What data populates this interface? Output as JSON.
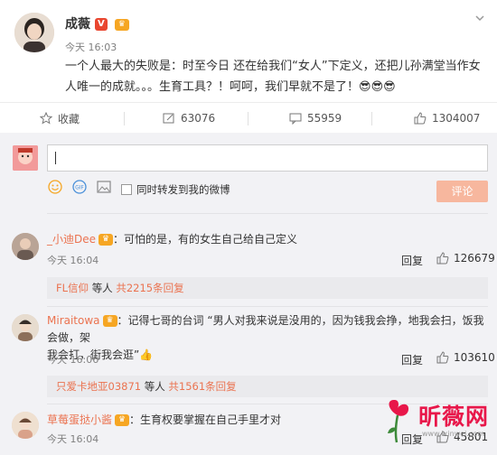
{
  "post": {
    "author": "成薇",
    "time": "今天 16:03",
    "text_line1": "一个人最大的失败是：时至今日 还在给我们“女人”下定义，还把儿孙满堂当作女",
    "text_line2": "人唯一的成就。。。生育工具？！呵呵，我们早就不是了！",
    "emoji": "😎😎😎"
  },
  "actions": {
    "favorite": "收藏",
    "repost": "63076",
    "comment": "55959",
    "like": "1304007"
  },
  "composer": {
    "value": "",
    "sync_label": "同时转发到我的微博",
    "submit": "评论"
  },
  "comments": [
    {
      "user": "_小迪Dee",
      "text": "：可怕的是，有的女生自己给自己定义",
      "time": "今天 16:04",
      "reply": "回复",
      "likes": "126679",
      "sub_user": "FL信仰",
      "sub_mid": "等人",
      "sub_more": "共2215条回复"
    },
    {
      "user": "Miraitowa",
      "text_line1": "：记得七哥的台词 “男人对我来说是没用的，因为钱我会挣，地我会扫，饭我会做，架",
      "text_line2": "我会打，街我会逛”",
      "time": "今天 16:06",
      "reply": "回复",
      "likes": "103610",
      "sub_user": "只爱卡地亚03871",
      "sub_mid": "等人",
      "sub_more": "共1561条回复"
    },
    {
      "user": "草莓蛋挞小酱",
      "text": "：生育权要掌握在自己手里才对",
      "time": "今天 16:04",
      "reply": "回复",
      "likes": "45801"
    }
  ],
  "watermark": {
    "title": "昕薇网",
    "url": "www.ixinwei.com"
  },
  "colors": {
    "link": "#eb7350",
    "button": "#f7b79e",
    "badge": "#f29c1f"
  }
}
